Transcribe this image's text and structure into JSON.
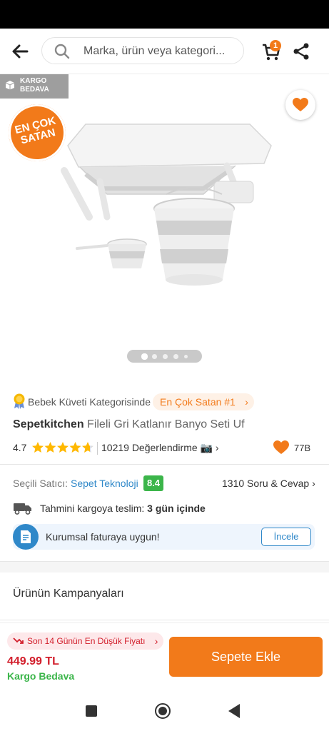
{
  "search": {
    "placeholder": "Marka, ürün veya kategori..."
  },
  "cart": {
    "count": "1"
  },
  "image": {
    "badge_kargo": "KARGO BEDAVA",
    "badge_kargo_l1": "KARGO",
    "badge_kargo_l2": "BEDAVA",
    "bestseller_sticker_l1": "EN ÇOK",
    "bestseller_sticker_l2": "SATAN",
    "carousel_total": 5,
    "carousel_active": 1
  },
  "category": {
    "text": "Bebek Küveti Kategorisinde",
    "badge": "En Çok Satan #1"
  },
  "product": {
    "brand": "Sepetkitchen",
    "name": "Fileli Gri Katlanır Banyo Seti Uf",
    "rating": "4.7",
    "rating_value": 4.7,
    "reviews": "10219 Değerlendirme",
    "likes": "77B"
  },
  "seller": {
    "label": "Seçili Satıcı:",
    "name": "Sepet Teknoloji",
    "score": "8.4",
    "qa": "1310 Soru & Cevap"
  },
  "shipping": {
    "text": "Tahmini kargoya teslim:",
    "days": "3 gün içinde"
  },
  "corporate": {
    "text": "Kurumsal faturaya uygun!",
    "button": "İncele"
  },
  "campaigns": {
    "title": "Ürünün Kampanyaları"
  },
  "bottom": {
    "low_price": "Son 14 Günün En Düşük Fiyatı",
    "price": "449.99 TL",
    "free_shipping": "Kargo Bedava",
    "add_to_cart": "Sepete Ekle"
  },
  "icons": {
    "back": "arrow-left-icon",
    "search": "search-icon",
    "cart": "cart-icon",
    "share": "share-icon",
    "favorite": "heart-icon",
    "shipping": "truck-icon",
    "invoice": "document-icon"
  },
  "colors": {
    "accent": "#f27a1a",
    "price": "#d21e2b",
    "success": "#3bb54a",
    "link": "#2f88c9"
  }
}
